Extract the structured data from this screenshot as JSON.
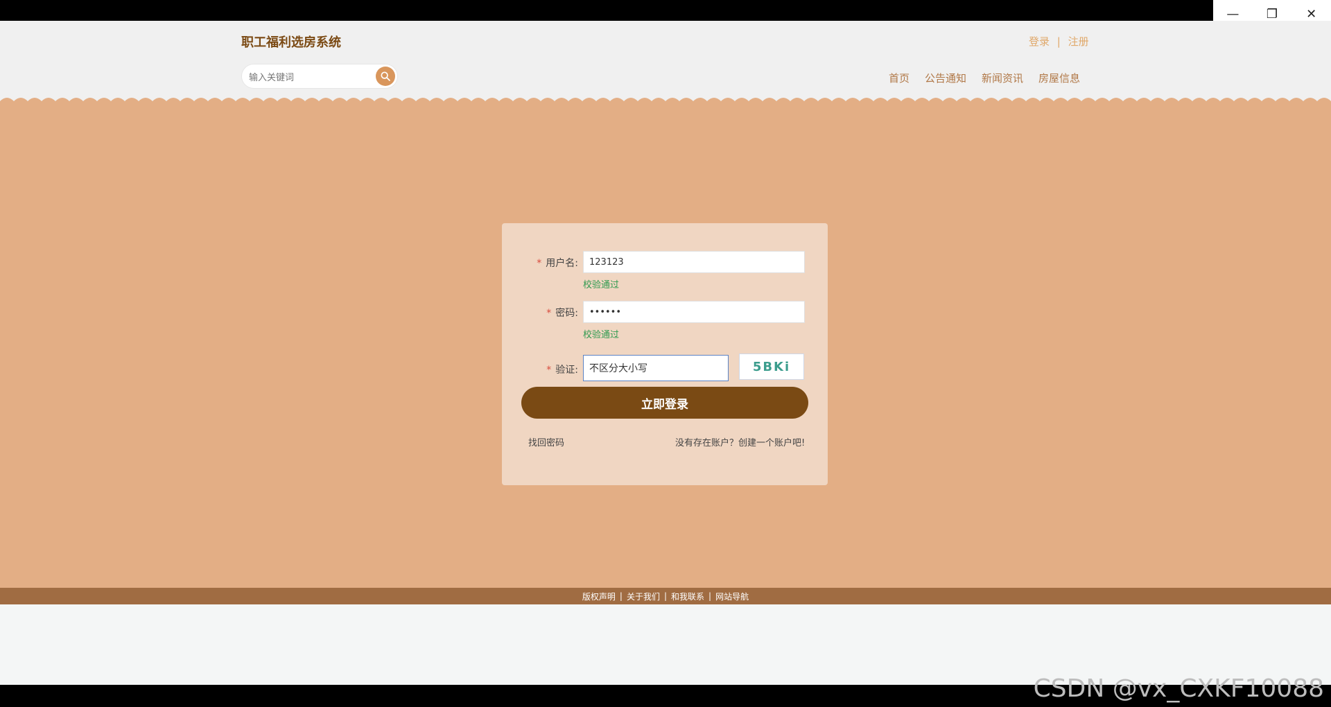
{
  "window": {
    "minimize_label": "—",
    "restore_label": "❐",
    "close_label": "✕"
  },
  "header": {
    "site_title": "职工福利选房系统",
    "auth": {
      "login": "登录",
      "sep": "|",
      "register": "注册"
    },
    "search": {
      "placeholder": "输入关键词"
    },
    "nav": [
      "首页",
      "公告通知",
      "新闻资讯",
      "房屋信息"
    ]
  },
  "form": {
    "username": {
      "label": "用户名:",
      "value": "123123",
      "status": "校验通过"
    },
    "password": {
      "label": "密码:",
      "value": "••••••",
      "status": "校验通过"
    },
    "captcha": {
      "label": "验证:",
      "value": "不区分大小写",
      "image_text": "5BKi"
    },
    "required_mark": "*",
    "submit_label": "立即登录",
    "forgot_password": "找回密码",
    "no_account": "没有存在账户？创建一个账户吧!"
  },
  "footer": {
    "items": [
      "版权声明",
      "关于我们",
      "和我联系",
      "网站导航"
    ],
    "separator": "|"
  },
  "watermark": "CSDN @vx_CXKF10088",
  "colors": {
    "brand_dark": "#7a4a14",
    "hero_bg": "#e3ae85",
    "panel_bg": "#f0d6c2",
    "footer_bg": "#a06c42",
    "ok_green": "#2f9a4f"
  }
}
